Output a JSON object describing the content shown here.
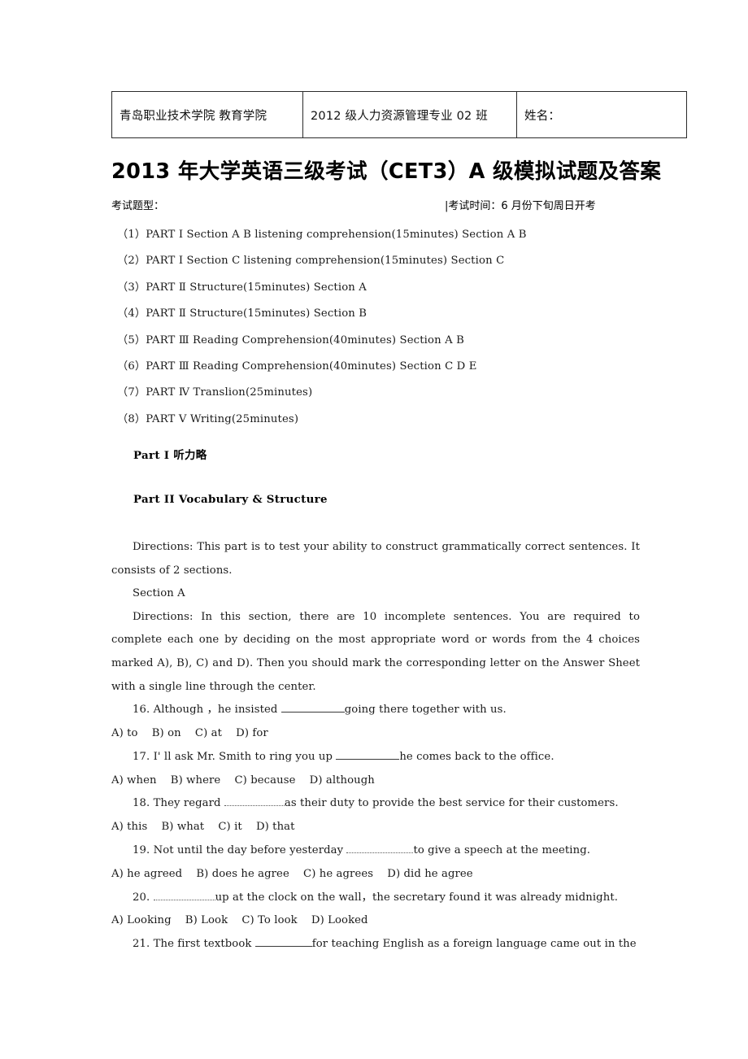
{
  "header_table": {
    "cells": [
      {
        "text": "青岛职业技术学院 教育学院"
      },
      {
        "text": "2012 级人力资源管理专业 02 班"
      },
      {
        "text": "姓名："
      }
    ]
  },
  "title": "2013 年大学英语三级考试（CET3）A 级模拟试题及答案",
  "meta": {
    "left": "考试题型：",
    "right": "|考试时间：6 月份下旬周日开考"
  },
  "exam_parts": [
    "（1）PART Ⅰ Section A B listening comprehension(15minutes) Section A B",
    "（2）PART Ⅰ Section C listening comprehension(15minutes) Section C",
    "（3）PART Ⅱ Structure(15minutes) Section A",
    "（4）PART Ⅱ Structure(15minutes) Section B",
    "（5）PART Ⅲ Reading Comprehension(40minutes) Section A B",
    "（6）PART Ⅲ Reading Comprehension(40minutes) Section C D E",
    "（7）PART Ⅳ Translion(25minutes)",
    "（8）PART Ⅴ Writing(25minutes)"
  ],
  "part1_heading": "Part Ⅰ  听力略",
  "part2_heading": "Part ⅠⅠ Vocabulary & Structure",
  "directions_1": "Directions: This part is to test your ability to construct grammatically correct sentences. It consists of 2 sections.",
  "section_a_label": "Section A",
  "directions_2": "Directions: In this section, there are 10 incomplete sentences. You are required to complete each one by deciding on the most appropriate word or words from the 4 choices marked A), B), C) and D). Then you should mark the corresponding letter on the Answer Sheet with a single line through the center.",
  "questions": [
    {
      "number": "16.",
      "stem_before": "Although ，he insisted",
      "stem_after": "going there together with us.",
      "options": "A) to    B) on    C) at    D) for"
    },
    {
      "number": "17.",
      "stem_before": "I' ll ask Mr. Smith to ring you up",
      "stem_after": "he comes back to the office.",
      "options": "A) when    B) where    C) because    D) although"
    },
    {
      "number": "18.",
      "stem_before": "They regard",
      "stem_after": "as their duty to provide the best service for their customers.",
      "options": "A) this    B) what    C) it    D) that"
    },
    {
      "number": "19.",
      "stem_before": "Not until the day before yesterday",
      "stem_after": "to give a speech at the meeting.",
      "options": "A) he agreed    B) does he agree    C) he agrees    D) did he agree"
    },
    {
      "number": "20.",
      "stem_before": "",
      "stem_after": "up at the clock on the wall，the secretary found it was already midnight.",
      "options": "A) Looking    B) Look    C) To look    D) Looked"
    },
    {
      "number": "21.",
      "stem_before": "The first textbook",
      "stem_after": "for teaching English as a foreign language came out in the",
      "options": ""
    }
  ]
}
